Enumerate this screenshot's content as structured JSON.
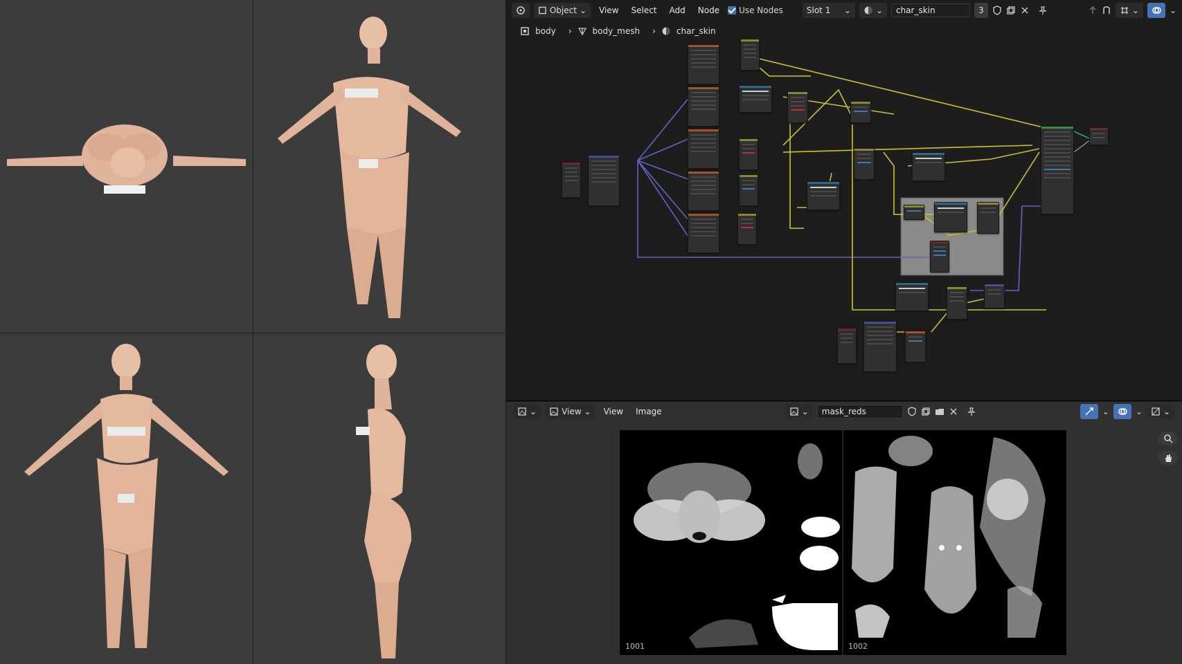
{
  "node_editor": {
    "header": {
      "mode": "Object",
      "menus": [
        "View",
        "Select",
        "Add",
        "Node"
      ],
      "use_nodes_label": "Use Nodes",
      "use_nodes_checked": true,
      "slot": "Slot 1",
      "material_name": "char_skin",
      "users_count": "3"
    },
    "breadcrumb": [
      "body",
      "body_mesh",
      "char_skin"
    ],
    "colors": {
      "wire_yellow": "#c9c330",
      "wire_blue": "#6363c7",
      "frame": "#8a8a8a",
      "background": "#1d1d1d"
    }
  },
  "image_editor": {
    "header": {
      "view_label": "View",
      "menus": [
        "View",
        "Image"
      ],
      "image_name": "mask_reds"
    },
    "tiles": [
      "1001",
      "1002"
    ]
  },
  "icons": [
    "editor-type-icon",
    "object-mode-icon",
    "material-icon",
    "shield-icon",
    "duplicate-icon",
    "close-icon",
    "pin-icon",
    "parent-up-icon",
    "snap-icon",
    "overlay-icon",
    "zoom-icon",
    "hand-icon",
    "image-icon",
    "folder-icon",
    "mesh-icon"
  ]
}
